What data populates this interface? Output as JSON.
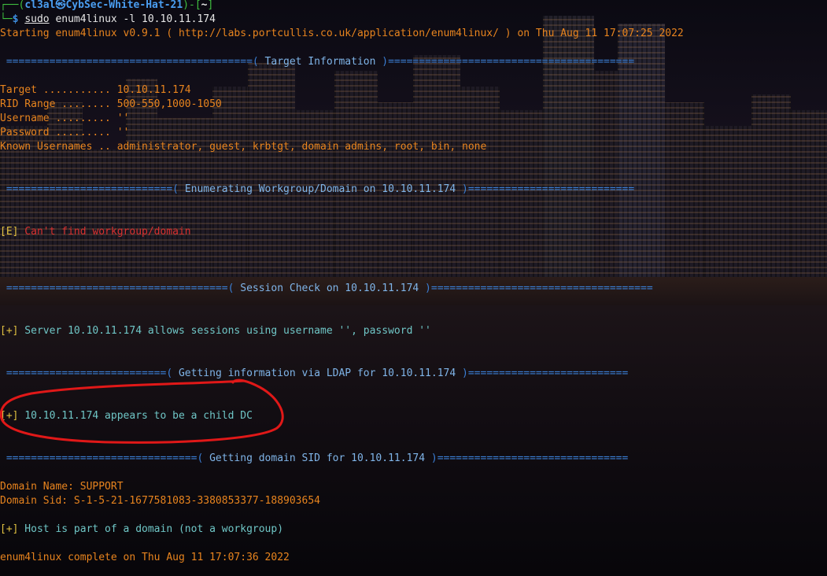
{
  "prompt": {
    "top_open": "┌──(",
    "user": "cl3al",
    "at_icon": "㉿",
    "host": "CybSec-White-Hat-21",
    "mid": ")-[",
    "dir": "~",
    "close": "]",
    "bottom": "└─",
    "dollar": "$",
    "sudo": "sudo",
    "command": "enum4linux -l 10.10.11.174"
  },
  "output": {
    "starting": "Starting enum4linux v0.9.1 ( http://labs.portcullis.co.uk/application/enum4linux/ ) on Thu Aug 11 17:07:25 2022",
    "sections": {
      "target_info": {
        "sep_left": " ========================================( ",
        "title": "Target Information",
        "sep_right": " )========================================"
      },
      "workgroup": {
        "sep_left": " ===========================( ",
        "title": "Enumerating Workgroup/Domain on 10.10.11.174",
        "sep_right": " )==========================="
      },
      "session": {
        "sep_left": " ====================================( ",
        "title": "Session Check on 10.10.11.174",
        "sep_right": " )===================================="
      },
      "ldap": {
        "sep_left": " ==========================( ",
        "title": "Getting information via LDAP for 10.10.11.174",
        "sep_right": " )=========================="
      },
      "sid": {
        "sep_left": " ===============================( ",
        "title": "Getting domain SID for 10.10.11.174",
        "sep_right": " )==============================="
      }
    },
    "target_lines": [
      "Target ........... 10.10.11.174",
      "RID Range ........ 500-550,1000-1050",
      "Username ......... ''",
      "Password ......... ''",
      "Known Usernames .. administrator, guest, krbtgt, domain admins, root, bin, none"
    ],
    "err_tag": "[E]",
    "err_msg": " Can't find workgroup/domain",
    "plus_tag": "[+]",
    "session_msg": " Server 10.10.11.174 allows sessions using username '', password ''",
    "ldap_msg": " 10.10.11.174 appears to be a child DC",
    "domain_name": "Domain Name: SUPPORT",
    "domain_sid": "Domain Sid: S-1-5-21-1677581083-3380853377-188903654",
    "host_msg": " Host is part of a domain (not a workgroup)",
    "complete": "enum4linux complete on Thu Aug 11 17:07:36 2022"
  },
  "colors": {
    "prompt_blue": "#3e8ee0",
    "output_orange": "#e8841e",
    "separator_blue": "#3b7fd6",
    "info_cyan": "#6fc6c6",
    "error_red": "#d83030",
    "annotation_red": "#e01818"
  }
}
